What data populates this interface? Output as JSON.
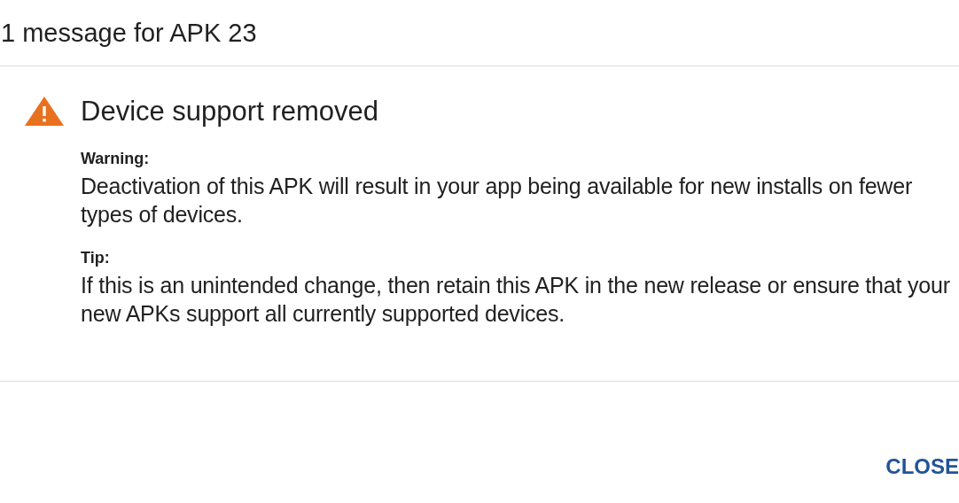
{
  "dialog": {
    "title": "1 message for APK 23",
    "message": {
      "kind": "warning",
      "heading": "Device support removed",
      "sections": [
        {
          "label": "Warning:",
          "text": "Deactivation of this APK will result in your app being available for new installs on fewer types of devices."
        },
        {
          "label": "Tip:",
          "text": "If this is an unintended change, then retain this APK in the new release or ensure that your new APKs support all currently supported devices."
        }
      ]
    },
    "buttons": [
      "CLOSE"
    ]
  }
}
